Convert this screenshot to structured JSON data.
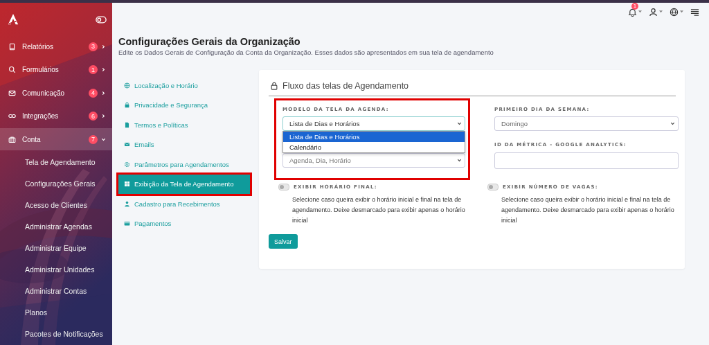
{
  "sidebar": {
    "items": [
      {
        "label": "Relatórios",
        "badge": "3",
        "expanded": false,
        "selected": false
      },
      {
        "label": "Formulários",
        "badge": "1",
        "expanded": false,
        "selected": false
      },
      {
        "label": "Comunicação",
        "badge": "4",
        "expanded": false,
        "selected": false
      },
      {
        "label": "Integrações",
        "badge": "6",
        "expanded": false,
        "selected": false
      },
      {
        "label": "Conta",
        "badge": "7",
        "expanded": true,
        "selected": true,
        "children": [
          {
            "label": "Tela de Agendamento"
          },
          {
            "label": "Configurações Gerais"
          },
          {
            "label": "Acesso de Clientes"
          },
          {
            "label": "Administrar Agendas"
          },
          {
            "label": "Administrar Equipe"
          },
          {
            "label": "Administrar Unidades"
          },
          {
            "label": "Administrar Contas"
          },
          {
            "label": "Planos"
          },
          {
            "label": "Pacotes de Notificações"
          }
        ]
      }
    ]
  },
  "topbar": {
    "notification_count": "1"
  },
  "page": {
    "title": "Configurações Gerais da Organização",
    "subtitle": "Edite os Dados Gerais de Configuração da Conta da Organização. Esses dados são apresentados em sua tela de agendamento"
  },
  "settings_nav": [
    {
      "label": "Localização e Horário",
      "selected": false,
      "highlighted": false
    },
    {
      "label": "Privacidade e Segurança",
      "selected": false,
      "highlighted": false
    },
    {
      "label": "Termos e Políticas",
      "selected": false,
      "highlighted": false
    },
    {
      "label": "Emails",
      "selected": false,
      "highlighted": false
    },
    {
      "label": "Parâmetros para Agendamentos",
      "selected": false,
      "highlighted": false
    },
    {
      "label": "Exibição da Tela de Agendamento",
      "selected": true,
      "highlighted": true
    },
    {
      "label": "Cadastro para Recebimentos",
      "selected": false,
      "highlighted": false
    },
    {
      "label": "Pagamentos",
      "selected": false,
      "highlighted": false
    }
  ],
  "card": {
    "title": "Fluxo das telas de Agendamento",
    "left": {
      "highlighted": true,
      "label": "MODELO DA TELA DA AGENDA:",
      "value": "Lista de Dias e Horários",
      "expanded": true,
      "options": [
        {
          "label": "Lista de Dias e Horários",
          "selected": true
        },
        {
          "label": "Calendário",
          "selected": false
        }
      ],
      "second_value": "Agenda, Dia, Horário"
    },
    "right": {
      "week_label": "PRIMEIRO DIA DA SEMANA:",
      "week_value": "Domingo",
      "metric_label": "ID DA MÉTRICA - GOOGLE ANALYTICS:"
    },
    "toggles": [
      {
        "label": "EXIBIR HORÁRIO FINAL:",
        "on": false,
        "description": "Selecione caso queira exibir o horário inicial e final na tela de agendamento. Deixe desmarcado para exibir apenas o horário inicial"
      },
      {
        "label": "EXIBIR NÚMERO DE VAGAS:",
        "on": false,
        "description": "Selecione caso queira exibir o horário inicial e final na tela de agendamento. Deixe desmarcado para exibir apenas o horário inicial"
      }
    ],
    "save_button": "Salvar"
  }
}
